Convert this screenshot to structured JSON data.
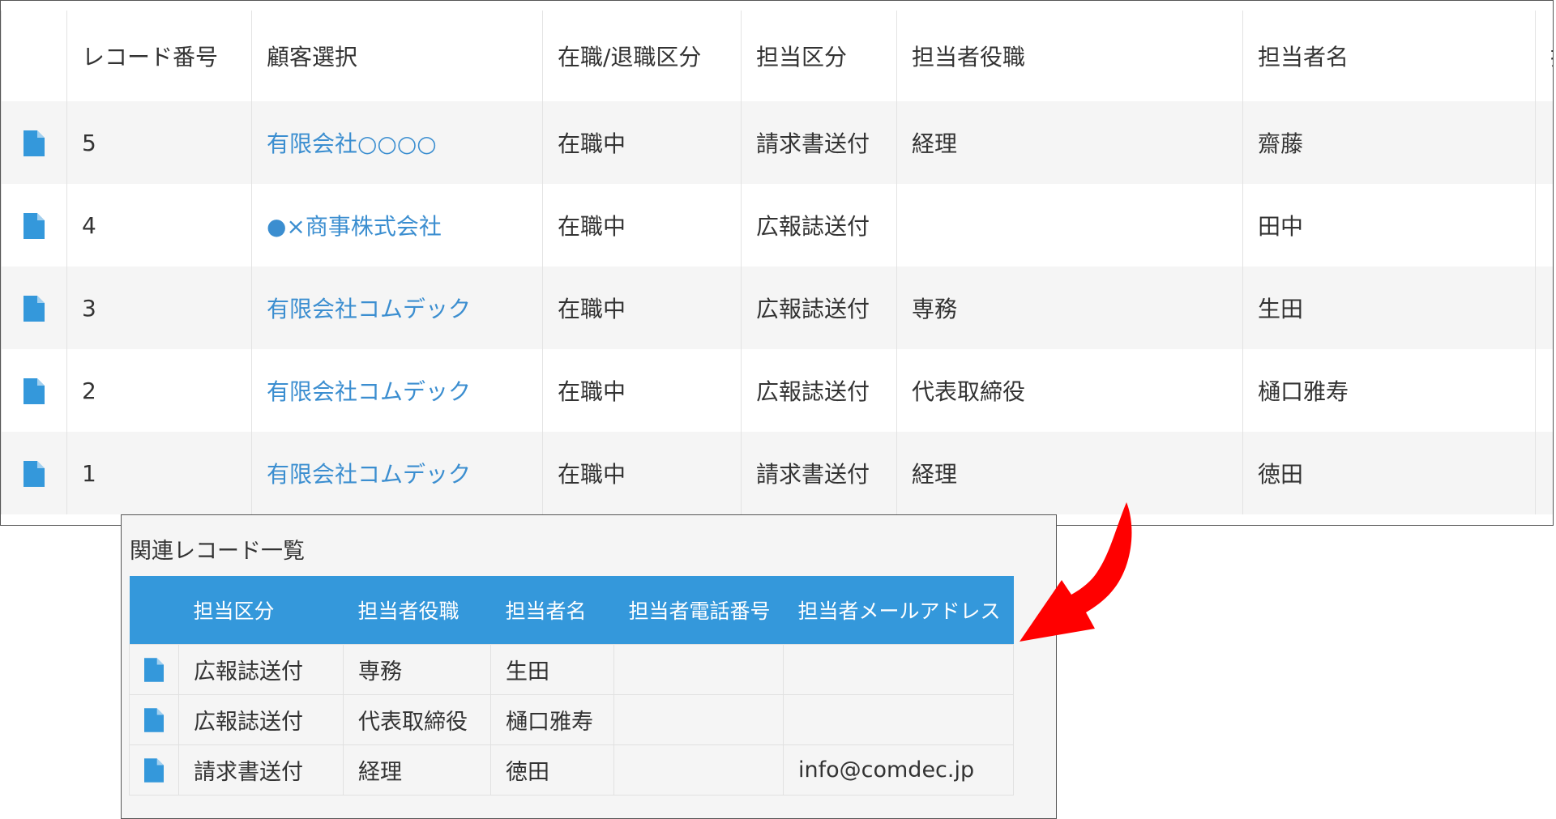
{
  "colors": {
    "link": "#3b8ed0",
    "header_blue": "#3498db",
    "doc_icon": "#3498db",
    "arrow": "#ff0000",
    "row_stripe": "#f5f5f5"
  },
  "main_table": {
    "columns": [
      "",
      "レコード番号",
      "顧客選択",
      "在職/退職区分",
      "担当区分",
      "担当者役職",
      "担当者名",
      "担"
    ],
    "rows": [
      {
        "icon": "document-icon",
        "number": "5",
        "customer": "有限会社○○○○",
        "status": "在職中",
        "category": "請求書送付",
        "title": "経理",
        "name": "齋藤"
      },
      {
        "icon": "document-icon",
        "number": "4",
        "customer": "●×商事株式会社",
        "status": "在職中",
        "category": "広報誌送付",
        "title": "",
        "name": "田中"
      },
      {
        "icon": "document-icon",
        "number": "3",
        "customer": "有限会社コムデック",
        "status": "在職中",
        "category": "広報誌送付",
        "title": "専務",
        "name": "生田"
      },
      {
        "icon": "document-icon",
        "number": "2",
        "customer": "有限会社コムデック",
        "status": "在職中",
        "category": "広報誌送付",
        "title": "代表取締役",
        "name": "樋口雅寿"
      },
      {
        "icon": "document-icon",
        "number": "1",
        "customer": "有限会社コムデック",
        "status": "在職中",
        "category": "請求書送付",
        "title": "経理",
        "name": "徳田"
      }
    ]
  },
  "related_records": {
    "title": "関連レコード一覧",
    "columns": [
      "",
      "担当区分",
      "担当者役職",
      "担当者名",
      "担当者電話番号",
      "担当者メールアドレス"
    ],
    "rows": [
      {
        "icon": "document-icon",
        "category": "広報誌送付",
        "title": "専務",
        "name": "生田",
        "phone": "",
        "email": ""
      },
      {
        "icon": "document-icon",
        "category": "広報誌送付",
        "title": "代表取締役",
        "name": "樋口雅寿",
        "phone": "",
        "email": ""
      },
      {
        "icon": "document-icon",
        "category": "請求書送付",
        "title": "経理",
        "name": "徳田",
        "phone": "",
        "email": "info@comdec.jp"
      }
    ]
  },
  "annotation": {
    "icon": "curved-arrow-icon"
  }
}
